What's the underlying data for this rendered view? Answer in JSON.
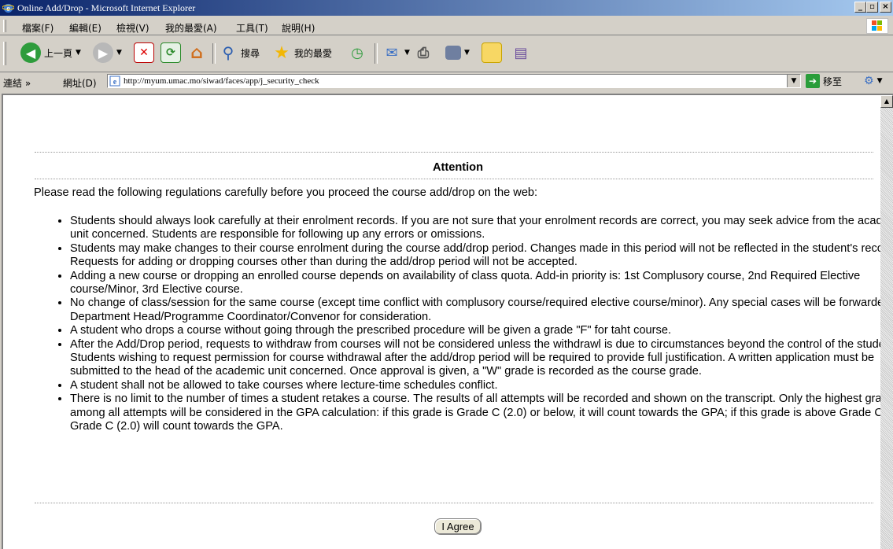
{
  "window": {
    "title": "Online Add/Drop - Microsoft Internet Explorer",
    "controls": {
      "minimize": "_",
      "maximize": "▫",
      "close": "×"
    }
  },
  "menu": {
    "items": [
      "檔案(F)",
      "編輯(E)",
      "檢視(V)",
      "我的最愛(A)",
      "工具(T)",
      "說明(H)"
    ]
  },
  "toolbar": {
    "back_label": "上一頁",
    "search_label": "搜尋",
    "favorites_label": "我的最愛"
  },
  "address": {
    "links_label": "連結",
    "label": "網址(D)",
    "url": "http://myum.umac.mo/siwad/faces/app/j_security_check",
    "go_label": "移至"
  },
  "page": {
    "heading": "Attention",
    "intro": "Please read the following regulations carefully before you proceed the course add/drop on the web:",
    "rules": [
      "Students should always look carefully at their enrolment records. If you are not sure that your enrolment records are correct, you may seek advice from the academic unit concerned. Students are responsible for following up any errors or omissions.",
      "Students may make changes to their course enrolment during the course add/drop period. Changes made in this period will not be reflected in the student's records. Requests for adding or dropping courses other than during the add/drop period will not be accepted.",
      "Adding a new course or dropping an enrolled course depends on availability of class quota. Add-in priority is: 1st Complusory course, 2nd Required Elective course/Minor, 3rd Elective course.",
      "No change of class/session for the same course (except time conflict with complusory course/required elective course/minor). Any special cases will be forwarded to Department Head/Programme Coordinator/Convenor for consideration.",
      "A student who drops a course without going through the prescribed procedure will be given a grade \"F\" for taht course.",
      "After the Add/Drop period, requests to withdraw from courses will not be considered unless the withdrawl is due to circumstances beyond the control of the student. Students wishing to request permission for course withdrawal after the add/drop period will be required to provide full justification. A written application must be submitted to the head of the academic unit concerned. Once approval is given, a \"W\" grade is recorded as the course grade.",
      "A student shall not be allowed to take courses where lecture-time schedules conflict.",
      "There is no limit to the number of times a student retakes a course. The results of all attempts will be recorded and shown on the transcript. Only the highest grade among all attempts will be considered in the GPA calculation: if this grade is Grade C (2.0) or below, it will count towards the GPA; if this grade is above Grade C, only Grade C (2.0) will count towards the GPA."
    ],
    "agree_label": "I Agree"
  },
  "colors": {
    "title_bar_start": "#0a246a",
    "title_bar_end": "#a6caf0",
    "chrome": "#d4d0c8"
  }
}
